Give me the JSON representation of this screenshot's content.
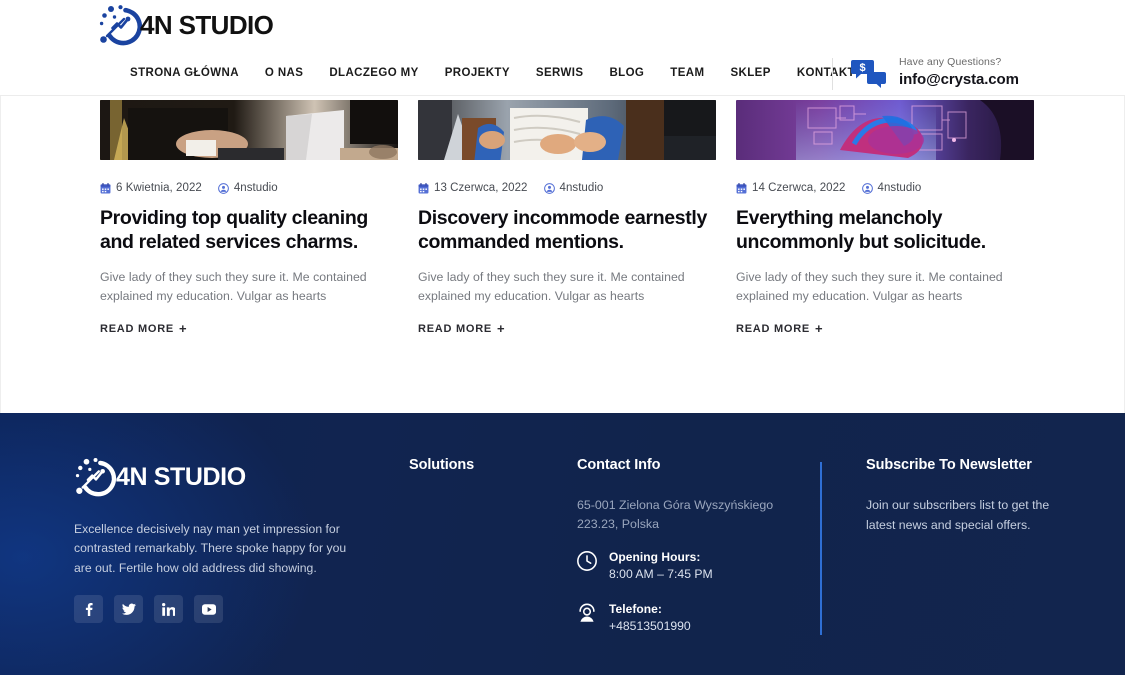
{
  "brand": {
    "name": "4N STUDIO",
    "logo_icon": "4n-studio-logo-icon",
    "footer_name": "4N STUDIO"
  },
  "header": {
    "nav": [
      {
        "label": "STRONA GŁÓWNA"
      },
      {
        "label": "O NAS"
      },
      {
        "label": "DLACZEGO MY"
      },
      {
        "label": "PROJEKTY"
      },
      {
        "label": "SERWIS"
      },
      {
        "label": "BLOG"
      },
      {
        "label": "TEAM"
      },
      {
        "label": "SKLEP"
      },
      {
        "label": "KONTAKT"
      }
    ],
    "contact": {
      "icon": "chat-dollar-icon",
      "question": "Have any Questions?",
      "email": "info@crysta.com"
    }
  },
  "main": {
    "read_more_label": "READ MORE",
    "read_more_plus": "+",
    "date_icon": "calendar-icon",
    "author_icon": "user-circle-icon",
    "cards": [
      {
        "image_alt": "businessman-typing-on-laptop-photo",
        "date": "6 Kwietnia, 2022",
        "author": "4nstudio",
        "title": "Providing top quality cleaning and related services charms.",
        "excerpt": "Give lady of they such they sure it. Me contained explained my education. Vulgar as hearts"
      },
      {
        "image_alt": "people-in-denim-working-photo",
        "date": "13 Czerwca, 2022",
        "author": "4nstudio",
        "title": "Discovery incommode earnestly commanded mentions.",
        "excerpt": "Give lady of they such they sure it. Me contained explained my education. Vulgar as hearts"
      },
      {
        "image_alt": "neon-purple-tech-hand-photo",
        "date": "14 Czerwca, 2022",
        "author": "4nstudio",
        "title": "Everything melancholy uncommonly but solicitude.",
        "excerpt": "Give lady of they such they sure it. Me contained explained my education. Vulgar as hearts"
      }
    ]
  },
  "footer": {
    "about": "Excellence decisively nay man yet impression for contrasted remarkably. There spoke happy for you are out. Fertile how old address did showing.",
    "socials": [
      {
        "name": "facebook-icon",
        "label": "f"
      },
      {
        "name": "twitter-icon",
        "label": "t"
      },
      {
        "name": "linkedin-icon",
        "label": "in"
      },
      {
        "name": "youtube-icon",
        "label": "yt"
      }
    ],
    "solutions": {
      "title": "Solutions",
      "items": []
    },
    "contact_info": {
      "title": "Contact Info",
      "address": "65-001 Zielona Góra Wyszyńskiego 223.23, Polska",
      "hours": {
        "icon": "clock-icon",
        "label": "Opening Hours:",
        "value": "8:00 AM – 7:45 PM"
      },
      "phone": {
        "icon": "support-person-icon",
        "label": "Telefone:",
        "value": "+48513501990"
      }
    },
    "newsletter": {
      "title": "Subscribe To Newsletter",
      "text": "Join our subscribers list to get the latest news and special offers."
    }
  },
  "colors": {
    "brand_blue": "#1a43a0",
    "accent_line": "#2f6fd4",
    "footer_bg": "#112450",
    "muted_text": "#76797f"
  }
}
